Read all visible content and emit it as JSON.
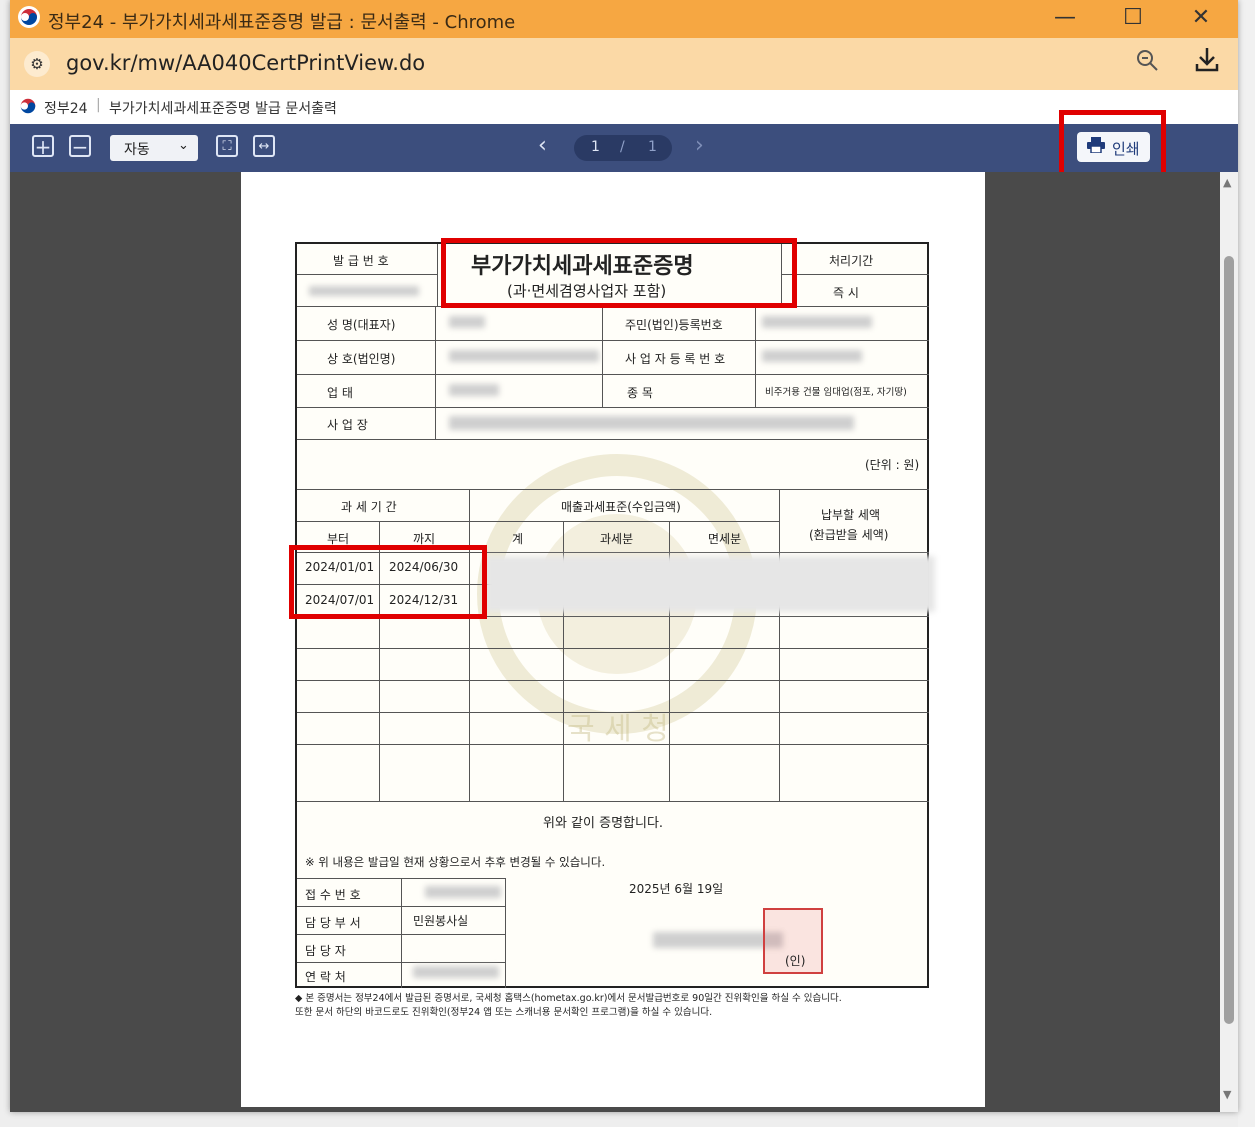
{
  "window": {
    "title": "정부24 - 부가가치세과세표준증명 발급 : 문서출력 - Chrome",
    "url": "gov.kr/mw/AA040CertPrintView.do",
    "icons": [
      "korea-emblem-icon",
      "minimize-icon",
      "maximize-icon",
      "close-icon",
      "site-settings-icon",
      "zoom-icon",
      "download-icon"
    ]
  },
  "tabline": {
    "site": "정부24",
    "separator": "|",
    "doc_title": "부가가치세과세표준증명 발급 문서출력"
  },
  "toolbar": {
    "zoom_in": "+",
    "zoom_out": "−",
    "zoom_value": "자동",
    "page_current": "1",
    "page_sep": "/",
    "page_total": "1",
    "print_label": "인쇄"
  },
  "cert": {
    "issue_no_label": "발 급 번 호",
    "title": "부가가치세과세표준증명",
    "subtitle": "(과·면세겸영사업자 포함)",
    "period_label": "처리기간",
    "period_value": "즉   시",
    "rows": [
      {
        "label": "성 명(대표자)",
        "label2": "주민(법인)등록번호"
      },
      {
        "label": "상 호(법인명)",
        "label2": "사 업 자 등 록 번 호"
      },
      {
        "label": "업          태",
        "label2": "종          목",
        "value2": "비주거용 건물 임대업(점포, 자기땅)"
      },
      {
        "label": "사    업    장"
      }
    ],
    "unit": "(단위 : 원)",
    "headers": {
      "tax_period": "과  세  기  간",
      "from": "부터",
      "to": "까지",
      "sales": "매출과세표준(수입금액)",
      "total": "계",
      "taxable": "과세분",
      "exempt": "면세분",
      "payable": "납부할 세액",
      "payable2": "(환급받을 세액)"
    },
    "periods": [
      {
        "from": "2024/01/01",
        "to": "2024/06/30"
      },
      {
        "from": "2024/07/01",
        "to": "2024/12/31"
      }
    ],
    "certify": "위와 같이 증명합니다.",
    "notice": "※ 위 내용은 발급일 현재 상황으로서 추후 변경될 수 있습니다.",
    "receipt_label": "접  수  번  호",
    "dept_label": "담  당  부  서",
    "dept_value": "민원봉사실",
    "person_label": "담     당     자",
    "contact_label": "연     락     처",
    "date": "2025년 6월 19일",
    "seal": "(인)",
    "watermark": "국 세 청",
    "footnote1": "◆ 본 증명서는 정부24에서 발급된 증명서로, 국세청 홈택스(hometax.go.kr)에서 문서발급번호로 90일간 진위확인을 하실 수 있습니다.",
    "footnote2": "또한 문서 하단의 바코드로도 진위확인(정부24 앱 또는 스캐너용 문서확인 프로그램)을 하실 수 있습니다."
  },
  "colors": {
    "titlebar": "#f6a742",
    "addressbar": "#fbd9a6",
    "toolbar": "#3c4e7d",
    "highlight": "#e00000"
  }
}
